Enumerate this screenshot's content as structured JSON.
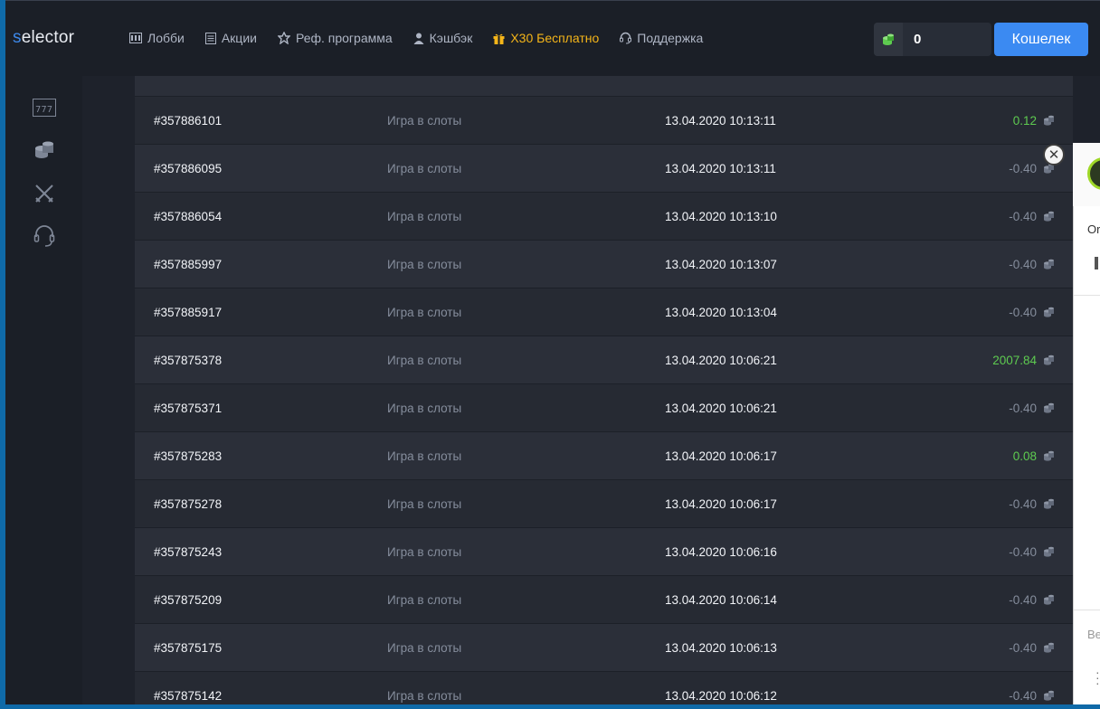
{
  "header": {
    "logo_first": "s",
    "logo_rest": "elector",
    "nav": [
      {
        "label": "Лобби",
        "icon": "lobby-icon"
      },
      {
        "label": "Акции",
        "icon": "promotions-icon"
      },
      {
        "label": "Реф. программа",
        "icon": "referral-icon"
      },
      {
        "label": "Кэшбэк",
        "icon": "user-icon"
      },
      {
        "label": "Х30 Бесплатно",
        "icon": "gift-icon"
      },
      {
        "label": "Поддержка",
        "icon": "headset-icon"
      }
    ],
    "balance": "0",
    "wallet_label": "Кошелек"
  },
  "sidebar": {
    "items": [
      "slots-icon",
      "coins-icon",
      "swords-icon",
      "headset-icon"
    ]
  },
  "transactions": [
    {
      "id": "#357886101",
      "type": "Игра в слоты",
      "date": "13.04.2020 10:13:11",
      "amount": "0.12",
      "positive": true
    },
    {
      "id": "#357886095",
      "type": "Игра в слоты",
      "date": "13.04.2020 10:13:11",
      "amount": "-0.40",
      "positive": false
    },
    {
      "id": "#357886054",
      "type": "Игра в слоты",
      "date": "13.04.2020 10:13:10",
      "amount": "-0.40",
      "positive": false
    },
    {
      "id": "#357885997",
      "type": "Игра в слоты",
      "date": "13.04.2020 10:13:07",
      "amount": "-0.40",
      "positive": false
    },
    {
      "id": "#357885917",
      "type": "Игра в слоты",
      "date": "13.04.2020 10:13:04",
      "amount": "-0.40",
      "positive": false
    },
    {
      "id": "#357875378",
      "type": "Игра в слоты",
      "date": "13.04.2020 10:06:21",
      "amount": "2007.84",
      "positive": true
    },
    {
      "id": "#357875371",
      "type": "Игра в слоты",
      "date": "13.04.2020 10:06:21",
      "amount": "-0.40",
      "positive": false
    },
    {
      "id": "#357875283",
      "type": "Игра в слоты",
      "date": "13.04.2020 10:06:17",
      "amount": "0.08",
      "positive": true
    },
    {
      "id": "#357875278",
      "type": "Игра в слоты",
      "date": "13.04.2020 10:06:17",
      "amount": "-0.40",
      "positive": false
    },
    {
      "id": "#357875243",
      "type": "Игра в слоты",
      "date": "13.04.2020 10:06:16",
      "amount": "-0.40",
      "positive": false
    },
    {
      "id": "#357875209",
      "type": "Игра в слоты",
      "date": "13.04.2020 10:06:14",
      "amount": "-0.40",
      "positive": false
    },
    {
      "id": "#357875175",
      "type": "Игра в слоты",
      "date": "13.04.2020 10:06:13",
      "amount": "-0.40",
      "positive": false
    },
    {
      "id": "#357875142",
      "type": "Игра в слоты",
      "date": "13.04.2020 10:06:12",
      "amount": "-0.40",
      "positive": false
    }
  ],
  "chat": {
    "message": "Or",
    "input_placeholder": "Be"
  },
  "colors": {
    "accent": "#3b8af2",
    "promo": "#f5b519",
    "positive": "#5ecb50",
    "negative": "#858d9c"
  }
}
